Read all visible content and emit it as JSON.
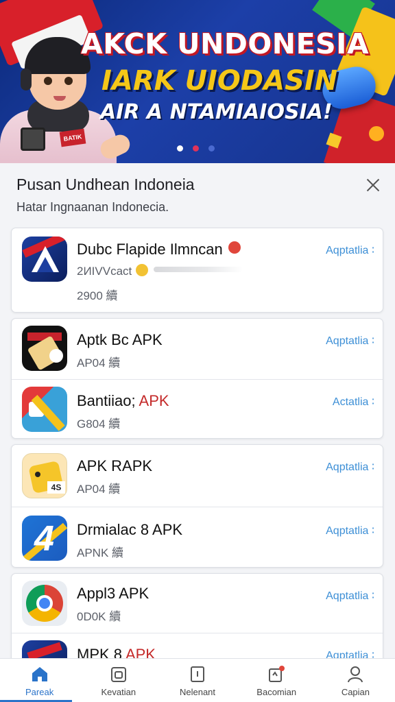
{
  "banner": {
    "line1": "AKCK UNDONESIA",
    "line2": "IARK UIODASIN",
    "line3": "AIR A NTAMIAIOSIA!",
    "badge": "BATIK",
    "slides": {
      "total": 3,
      "active_index": 1
    },
    "colors": {
      "dot_active": "#e0335a",
      "dot_inactive": "#ffffff",
      "dot_third": "#4a6ad0"
    }
  },
  "sheet": {
    "title": "Pusan Undhean Indoneia",
    "subtitle": "Hatar Ingnaanan Indonecia."
  },
  "apps": [
    {
      "name": "Dubc Flapide Ilmncan",
      "meta": "2ИIVVcact",
      "size": "2900 續",
      "action": "Aqptatlia ∶"
    },
    {
      "name": "Aptk Bc APK",
      "size": "AP04 續",
      "action": "Aqptatlia ∶"
    },
    {
      "name": "Bantiiao;",
      "name_apk": "APK",
      "size": "G804 續",
      "action": "Actatlia ∶"
    },
    {
      "name": "APK RAPK",
      "size": "AP04 續",
      "action": "Aqptatlia ∶"
    },
    {
      "name": "Drmialac 8 APK",
      "size": "APNK 續",
      "action": "Aqptatlia ∶"
    },
    {
      "name": "Appl3 APK",
      "size": "0D0K 續",
      "action": "Aqptatlia ∶"
    },
    {
      "name": "MPK 8",
      "name_apk": "APK",
      "action": "Aqptatlia ∶"
    }
  ],
  "nav": [
    {
      "label": "Pareak",
      "icon": "home-icon",
      "active": true
    },
    {
      "label": "Kevatian",
      "icon": "calendar-icon",
      "active": false
    },
    {
      "label": "Nelenant",
      "icon": "document-icon",
      "active": false
    },
    {
      "label": "Bacomian",
      "icon": "notification-icon",
      "active": false
    },
    {
      "label": "Capian",
      "icon": "profile-icon",
      "active": false
    }
  ],
  "colors": {
    "accent": "#2a73c9",
    "action_link": "#3d8fd6",
    "apk_red": "#c42a2a"
  }
}
